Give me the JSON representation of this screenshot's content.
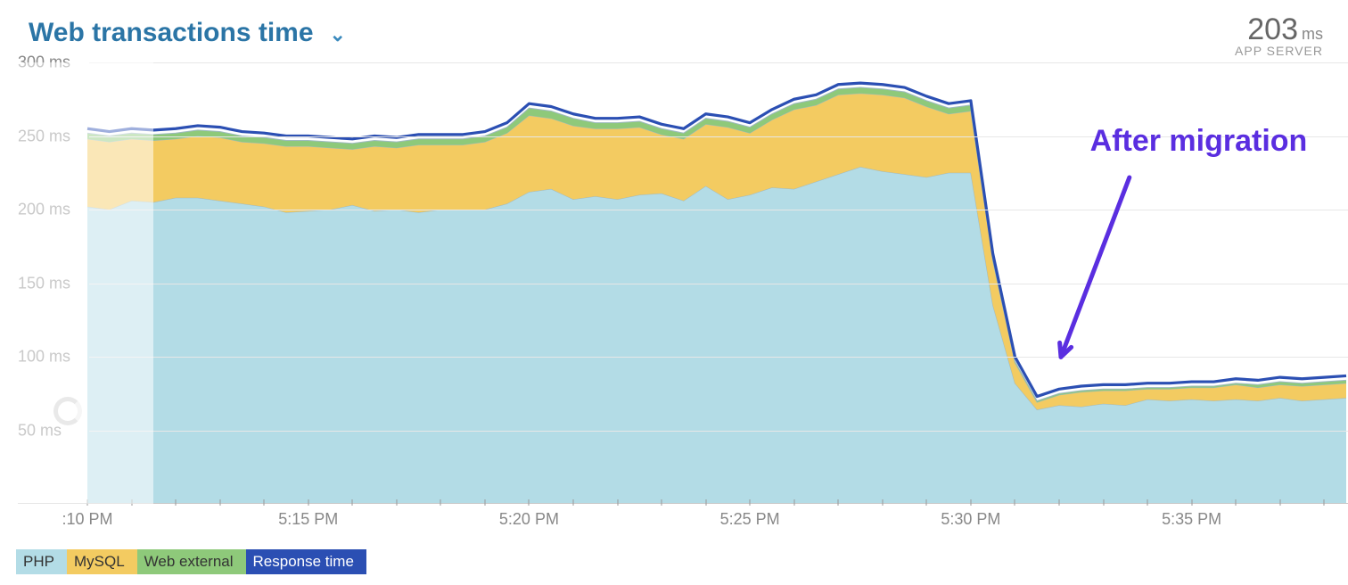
{
  "title": "Web transactions time",
  "top_right": {
    "value": "203",
    "unit": "ms",
    "sub": "APP SERVER"
  },
  "annotation_text": "After migration",
  "legend": [
    {
      "name": "PHP",
      "color": "#b3dce6"
    },
    {
      "name": "MySQL",
      "color": "#f3cb61"
    },
    {
      "name": "Web external",
      "color": "#8ec97a"
    },
    {
      "name": "Response time",
      "color": "#2b4fb3"
    }
  ],
  "colors": {
    "php": "#b3dce6",
    "mysql": "#f3cb61",
    "web_external": "#8ec97a",
    "response_line": "#2b4fb3",
    "grid": "#e7e7e7",
    "accent": "#5a2ee0"
  },
  "chart_data": {
    "type": "area",
    "title": "Web transactions time",
    "ylabel": "ms",
    "y_ticks": [
      50,
      100,
      150,
      200,
      250,
      300
    ],
    "x_ticks": [
      ":10 PM",
      "5:15 PM",
      "5:20 PM",
      "5:25 PM",
      "5:30 PM",
      "5:35 PM"
    ],
    "ylim": [
      0,
      300
    ],
    "xlim_minutes": [
      10,
      38.5
    ],
    "x_minor_step_minutes": 1,
    "highlight_range_minutes": [
      10,
      11.5
    ],
    "x_minutes": [
      10,
      10.5,
      11,
      11.5,
      12,
      12.5,
      13,
      13.5,
      14,
      14.5,
      15,
      15.5,
      16,
      16.5,
      17,
      17.5,
      18,
      18.5,
      19,
      19.5,
      20,
      20.5,
      21,
      21.5,
      22,
      22.5,
      23,
      23.5,
      24,
      24.5,
      25,
      25.5,
      26,
      26.5,
      27,
      27.5,
      28,
      28.5,
      29,
      29.5,
      30,
      30.5,
      31,
      31.5,
      32,
      32.5,
      33,
      33.5,
      34,
      34.5,
      35,
      35.5,
      36,
      36.5,
      37,
      37.5,
      38,
      38.5
    ],
    "series": [
      {
        "name": "PHP",
        "color": "#b3dce6",
        "values": [
          202,
          200,
          206,
          205,
          208,
          208,
          206,
          204,
          202,
          198,
          199,
          200,
          203,
          199,
          200,
          198,
          200,
          200,
          200,
          204,
          212,
          214,
          207,
          209,
          207,
          210,
          211,
          206,
          216,
          207,
          210,
          215,
          214,
          219,
          224,
          229,
          226,
          224,
          222,
          225,
          225,
          135,
          82,
          64,
          67,
          66,
          68,
          67,
          71,
          70,
          71,
          70,
          71,
          70,
          72,
          70,
          71,
          72
        ]
      },
      {
        "name": "MySQL",
        "color": "#f3cb61",
        "values": [
          46,
          46,
          42,
          42,
          40,
          42,
          43,
          42,
          43,
          45,
          44,
          42,
          38,
          44,
          42,
          46,
          44,
          44,
          46,
          48,
          52,
          48,
          50,
          46,
          48,
          46,
          40,
          42,
          42,
          49,
          42,
          46,
          54,
          52,
          54,
          50,
          52,
          52,
          48,
          40,
          42,
          30,
          14,
          5,
          7,
          10,
          9,
          10,
          7,
          8,
          8,
          9,
          10,
          9,
          9,
          10,
          10,
          10
        ]
      },
      {
        "name": "Web external",
        "color": "#8ec97a",
        "values": [
          4,
          4,
          4,
          4,
          4,
          4,
          4,
          4,
          4,
          4,
          4,
          4,
          4,
          4,
          4,
          4,
          4,
          4,
          4,
          4,
          5,
          5,
          5,
          4,
          4,
          4,
          4,
          4,
          4,
          4,
          4,
          4,
          4,
          4,
          4,
          4,
          4,
          4,
          4,
          4,
          4,
          2,
          1,
          1,
          1,
          1,
          1,
          1,
          1,
          1,
          1,
          1,
          1,
          2,
          2,
          2,
          2,
          2
        ]
      }
    ],
    "response_line_offset": 3
  }
}
